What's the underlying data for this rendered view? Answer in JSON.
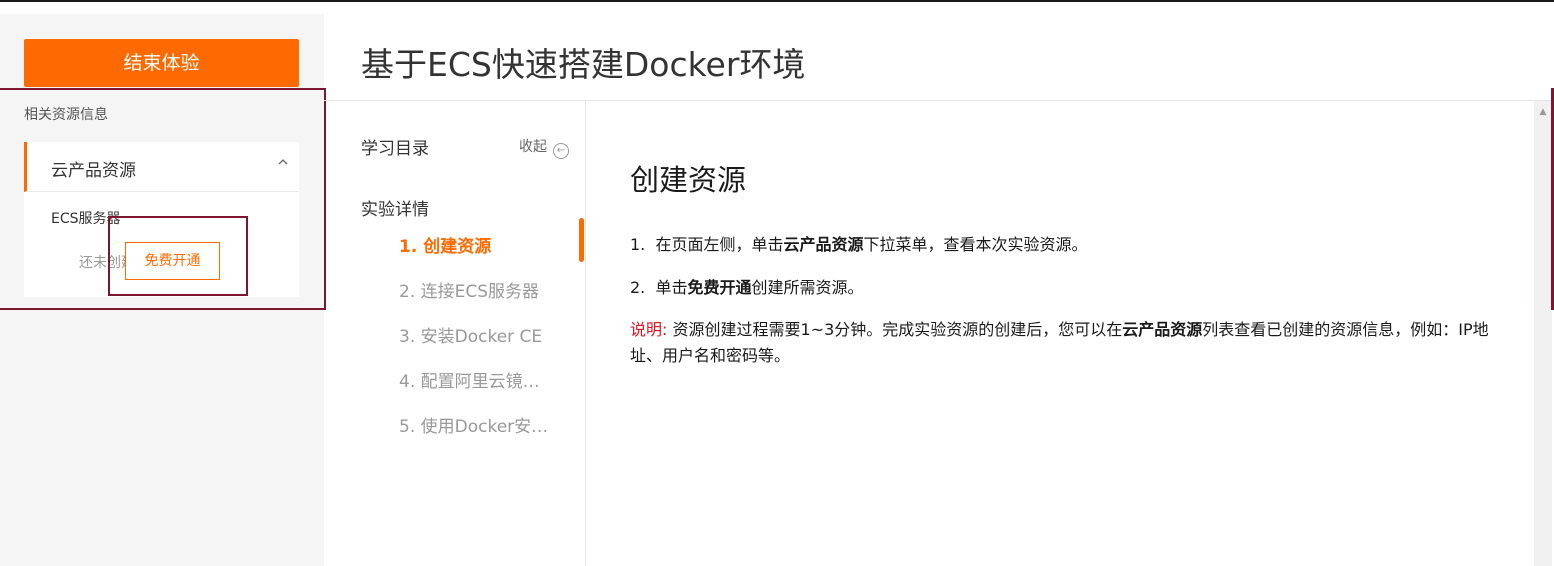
{
  "left_panel": {
    "end_button": "结束体验",
    "resource_title": "相关资源信息",
    "card_title": "云产品资源",
    "chevron_icon": "chevron-up-icon",
    "ecs_label": "ECS服务器",
    "status": "还未创建",
    "free_button": "免费开通"
  },
  "header": {
    "title": "基于ECS快速搭建Docker环境"
  },
  "toc": {
    "heading": "学习目录",
    "collapse_label": "收起",
    "collapse_icon": "arrow-left-circle-icon",
    "section": "实验详情",
    "items": [
      "1. 创建资源",
      "2. 连接ECS服务器",
      "3. 安装Docker CE",
      "4. 配置阿里云镜…",
      "5. 使用Docker安…"
    ],
    "active_index": 0
  },
  "content": {
    "title": "创建资源",
    "step1": {
      "num": "1.",
      "pre": "在页面左侧，单击",
      "bold": "云产品资源",
      "post": "下拉菜单，查看本次实验资源。"
    },
    "step2": {
      "num": "2.",
      "pre": "单击",
      "bold": "免费开通",
      "post": "创建所需资源。"
    },
    "note": {
      "label": "说明:",
      "pre": "资源创建过程需要1~3分钟。完成实验资源的创建后，您可以在",
      "bold": "云产品资源",
      "post": "列表查看已创建的资源信息，例如：IP地址、用户名和密码等。"
    }
  },
  "colors": {
    "accent": "#ff6a00",
    "highlight_border": "#7b1730",
    "note_label": "#e0141e"
  }
}
